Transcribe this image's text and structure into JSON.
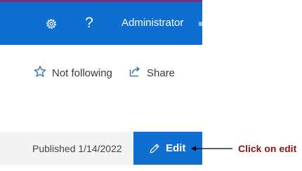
{
  "header": {
    "settings_icon": "gear-icon",
    "help_label": "?",
    "user_name": "Administrator",
    "colors": {
      "bar": "#0f6fd0",
      "accent_line": "#7a2e7e"
    }
  },
  "actions": {
    "follow": {
      "icon": "star-icon",
      "label": "Not following"
    },
    "share": {
      "icon": "share-icon",
      "label": "Share"
    }
  },
  "footer": {
    "published_text": "Published 1/14/2022",
    "edit": {
      "icon": "pencil-icon",
      "label": "Edit"
    }
  },
  "annotation": {
    "text": "Click on edit",
    "color": "#8b1414"
  }
}
